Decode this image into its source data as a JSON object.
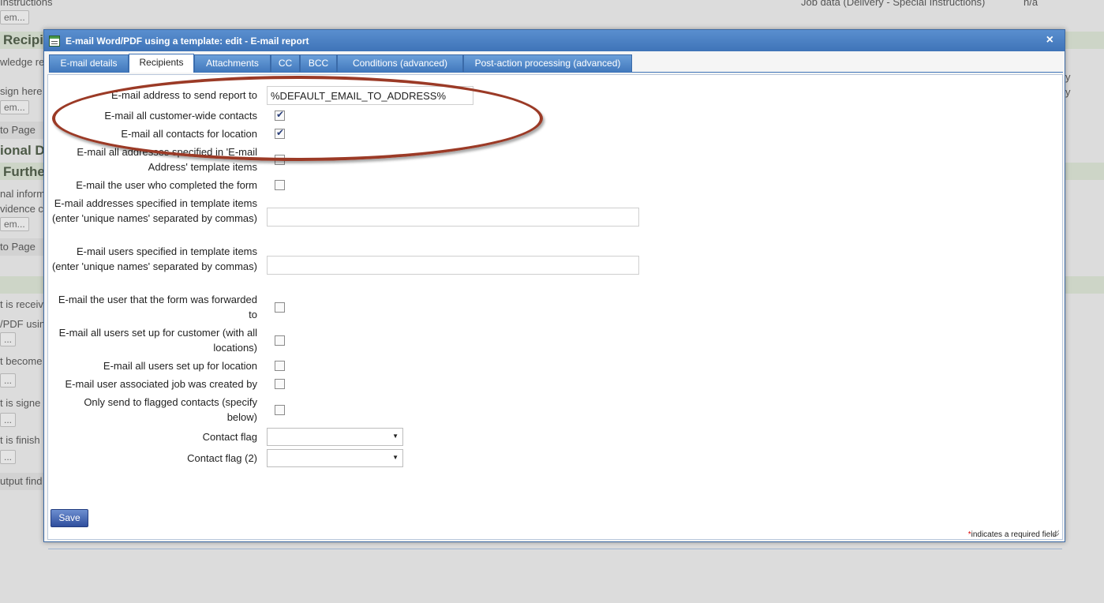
{
  "background": {
    "texts": {
      "instructions": "Instructions",
      "job_data": "Job data (Delivery - Special Instructions)",
      "na": "n/a",
      "item1": "em...",
      "recipients_head": "Recipi",
      "knowledge": "wledge re",
      "sign_here": "sign here",
      "item2": "em...",
      "to_page1": "to Page",
      "ional_d": "ional D",
      "furthe": "Furthe",
      "nal_inform": "nal inform",
      "vidence": "vidence c",
      "item3": "em...",
      "to_page2": "to Page",
      "is_received": "t is receiv",
      "pdf_using": "/PDF usin",
      "btn_a": "...",
      "becomes": "t become",
      "btn_b": "...",
      "signed": "t is signe",
      "btn_c": "...",
      "finished": "t is finish",
      "btn_d": "...",
      "output_find": "utput find",
      "right_y1": "y",
      "right_y2": "y"
    }
  },
  "dialog": {
    "title": "E-mail Word/PDF using a template: edit - E-mail report",
    "close": "×",
    "tabs": [
      {
        "label": "E-mail details"
      },
      {
        "label": "Recipients"
      },
      {
        "label": "Attachments"
      },
      {
        "label": "CC"
      },
      {
        "label": "BCC"
      },
      {
        "label": "Conditions (advanced)"
      },
      {
        "label": "Post-action processing (advanced)"
      }
    ],
    "fields": {
      "send_to_label": "E-mail address to send report to",
      "send_to_value": "%DEFAULT_EMAIL_TO_ADDRESS%",
      "customer_wide_label": "E-mail all customer-wide contacts",
      "location_contacts_label": "E-mail all contacts for location",
      "template_addresses_label": "E-mail all addresses specified in 'E-mail Address' template items",
      "completed_user_label": "E-mail the user who completed the form",
      "addresses_items_label": "E-mail addresses specified in template items (enter 'unique names' separated by commas)",
      "addresses_items_value": "",
      "users_items_label": "E-mail users specified in template items (enter 'unique names' separated by commas)",
      "users_items_value": "",
      "forwarded_label": "E-mail the user that the form was forwarded to",
      "customer_users_label": "E-mail all users set up for customer (with all locations)",
      "location_users_label": "E-mail all users set up for location",
      "job_creator_label": "E-mail user associated job was created by",
      "flagged_label": "Only send to flagged contacts (specify below)",
      "contact_flag_label": "Contact flag",
      "contact_flag_value": "",
      "contact_flag2_label": "Contact flag (2)",
      "contact_flag2_value": ""
    },
    "save_label": "Save",
    "required_star": "*",
    "required_note": "indicates a required field"
  }
}
